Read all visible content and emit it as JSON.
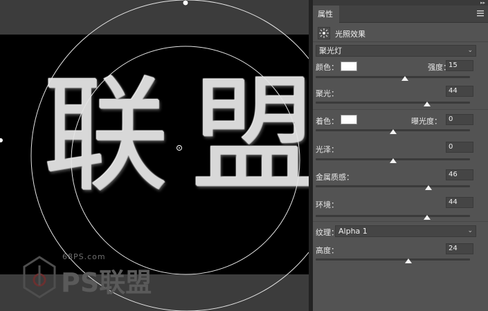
{
  "panel": {
    "tab": "属性",
    "title": "光照效果",
    "preset": "聚光灯",
    "color_label": "颜色：",
    "intensity_label": "强度：",
    "intensity_value": "15",
    "hotspot_label": "聚光：",
    "hotspot_value": "44",
    "colorize_label": "着色：",
    "exposure_label": "曝光度：",
    "exposure_value": "0",
    "gloss_label": "光泽：",
    "gloss_value": "0",
    "metallic_label": "金属质感：",
    "metallic_value": "46",
    "ambience_label": "环境：",
    "ambience_value": "44",
    "texture_label": "纹理：",
    "texture_value": "Alpha 1",
    "height_label": "高度：",
    "height_value": "24",
    "sliders": {
      "intensity": 0.58,
      "hotspot": 0.72,
      "exposure": 0.5,
      "gloss": 0.5,
      "metallic": 0.73,
      "ambience": 0.72,
      "height": 0.6
    },
    "color_swatch": "#ffffff",
    "colorize_swatch": "#ffffff"
  },
  "canvas": {
    "preview_text": "联盟",
    "watermark_url": "68PS.com",
    "watermark_logo": "PS联盟"
  },
  "colors": {
    "panel_bg": "#535353",
    "canvas_bg": "#000000"
  }
}
